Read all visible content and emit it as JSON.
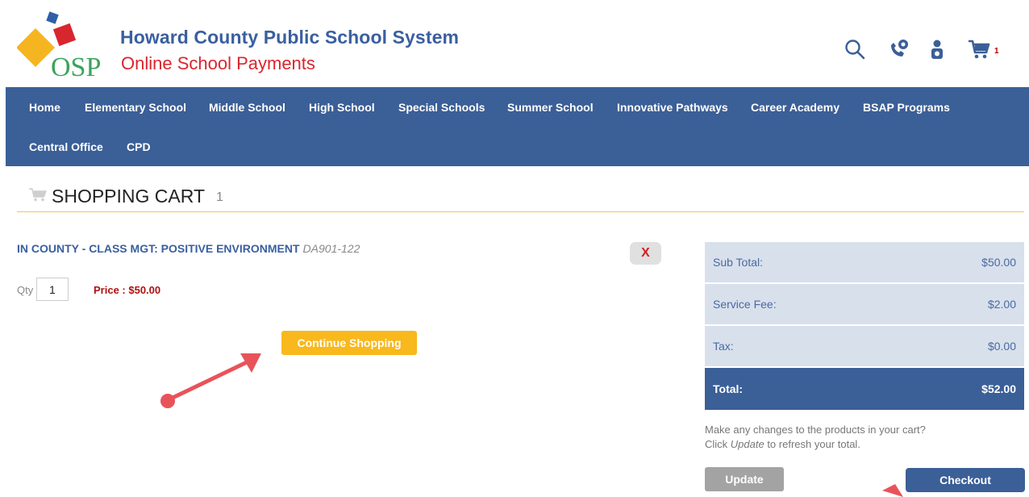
{
  "header": {
    "logo_text": "OSP",
    "org_name": "Howard County Public School System",
    "org_subtitle": "Online School Payments",
    "icons": [
      "search-icon",
      "phone-icon",
      "account-icon",
      "cart-icon"
    ],
    "cart_count": "1"
  },
  "nav": {
    "items": [
      {
        "label": "Home"
      },
      {
        "label": "Elementary School"
      },
      {
        "label": "Middle School"
      },
      {
        "label": "High School"
      },
      {
        "label": "Special Schools"
      },
      {
        "label": "Summer School"
      },
      {
        "label": "Innovative Pathways"
      },
      {
        "label": "Career Academy"
      },
      {
        "label": "BSAP Programs"
      },
      {
        "label": "Central Office"
      },
      {
        "label": "CPD"
      }
    ]
  },
  "cart": {
    "title": "SHOPPING CART",
    "count": "1",
    "item": {
      "name": "IN COUNTY - CLASS MGT: POSITIVE ENVIRONMENT",
      "code": "DA901-122",
      "remove_label": "X",
      "qty_label": "Qty",
      "qty_value": "1",
      "price_label": "Price : $50.00"
    },
    "continue_label": "Continue Shopping"
  },
  "summary": {
    "rows": [
      {
        "label": "Sub Total:",
        "value": "$50.00"
      },
      {
        "label": "Service Fee:",
        "value": "$2.00"
      },
      {
        "label": "Tax:",
        "value": "$0.00"
      }
    ],
    "total": {
      "label": "Total:",
      "value": "$52.00"
    },
    "help_line1": "Make any changes to the products in your cart?",
    "help_line2_prefix": "Click ",
    "help_line2_em": "Update",
    "help_line2_suffix": " to refresh your total.",
    "update_label": "Update",
    "checkout_label": "Checkout"
  },
  "colors": {
    "brand_blue": "#3b5f97",
    "brand_red": "#d8262f",
    "accent_yellow": "#f9b81c",
    "annotation": "#e8535a"
  }
}
